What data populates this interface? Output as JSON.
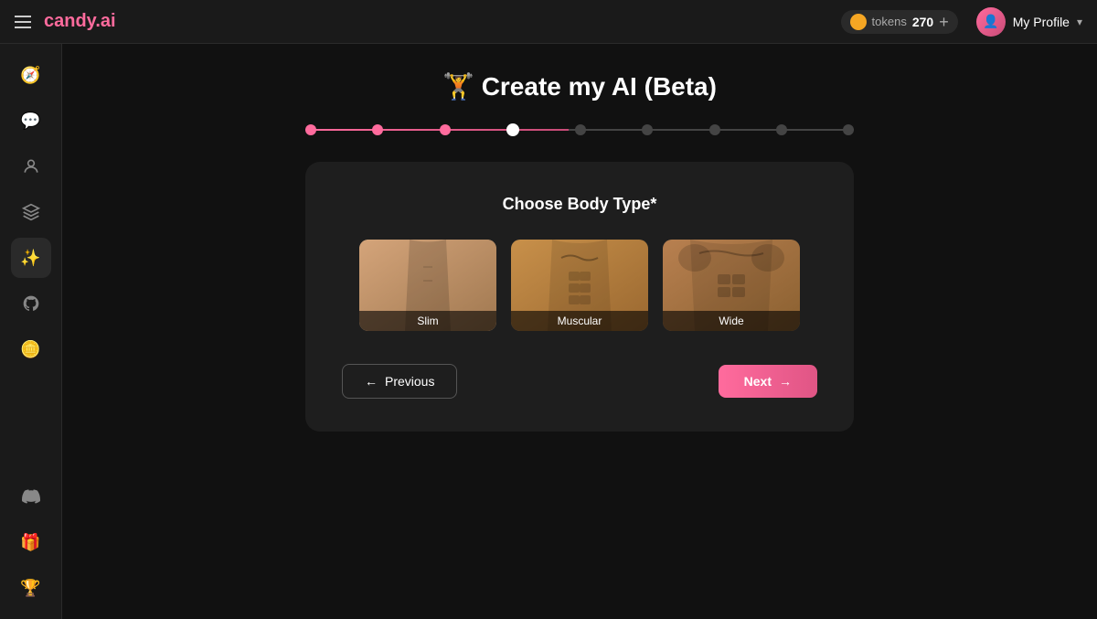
{
  "navbar": {
    "hamburger_label": "Menu",
    "brand_text": "candy",
    "brand_suffix": ".ai",
    "tokens_label": "tokens",
    "tokens_count": "270",
    "add_label": "+",
    "profile_name": "My Profile",
    "chevron": "▾"
  },
  "sidebar": {
    "items": [
      {
        "id": "explore",
        "icon": "🧭",
        "label": "Explore"
      },
      {
        "id": "chat",
        "icon": "💬",
        "label": "Chat"
      },
      {
        "id": "models",
        "icon": "🖼",
        "label": "Models"
      },
      {
        "id": "create",
        "icon": "🎭",
        "label": "Create"
      },
      {
        "id": "magic",
        "icon": "✨",
        "label": "Magic"
      },
      {
        "id": "github",
        "icon": "⬡",
        "label": "GitHub"
      },
      {
        "id": "coin",
        "icon": "🪙",
        "label": "Coin"
      }
    ],
    "bottom_items": [
      {
        "id": "discord",
        "icon": "◈",
        "label": "Discord"
      },
      {
        "id": "gift",
        "icon": "🎁",
        "label": "Gift"
      },
      {
        "id": "trophy",
        "icon": "🏆",
        "label": "Trophy"
      }
    ]
  },
  "page": {
    "title": "🏋 Create my AI (Beta)",
    "stepper": {
      "total_steps": 9,
      "completed_steps": 3,
      "active_step": 4
    },
    "card": {
      "title": "Choose Body Type*",
      "body_types": [
        {
          "id": "slim",
          "label": "Slim"
        },
        {
          "id": "muscular",
          "label": "Muscular"
        },
        {
          "id": "wide",
          "label": "Wide"
        }
      ],
      "prev_button": "← Previous",
      "next_button": "Next →"
    }
  }
}
